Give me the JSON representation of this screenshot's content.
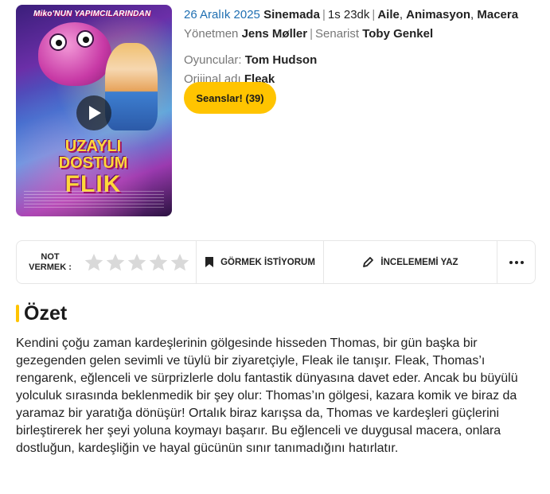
{
  "poster": {
    "topline": "NUN YAPIMCILARINDAN",
    "topline_brand": "Miko",
    "logo_line1": "UZAYLI DOSTUM",
    "logo_line2": "FLIK"
  },
  "meta": {
    "date": "26 Aralık 2025",
    "where": "Sinemada",
    "duration": "1s 23dk",
    "genres": [
      "Aile",
      "Animasyon",
      "Macera"
    ],
    "director_label": "Yönetmen",
    "director": "Jens Møller",
    "writer_label": "Senarist",
    "writer": "Toby Genkel",
    "cast_label": "Oyuncular:",
    "cast": "Tom Hudson",
    "original_label": "Orijinal adı",
    "original_title": "Fleak"
  },
  "sessions_button": "Seanslar! (39)",
  "actions": {
    "rate_label_1": "NOT",
    "rate_label_2": "VERMEK :",
    "star_count": 5,
    "star_color": "#d9d9d9",
    "watch_label": "GÖRMEK İSTİYORUM",
    "review_label": "İNCELEMEMİ YAZ"
  },
  "summary": {
    "title": "Özet",
    "text": "Kendini çoğu zaman kardeşlerinin gölgesinde hisseden Thomas, bir gün başka bir gezegenden gelen sevimli ve tüylü bir ziyaretçiyle, Fleak ile tanışır. Fleak, Thomas’ı rengarenk, eğlenceli ve sürprizlerle dolu fantastik dünyasına davet eder. Ancak bu büyülü yolculuk sırasında beklenmedik bir şey olur: Thomas’ın gölgesi, kazara komik ve biraz da yaramaz bir yaratığa dönüşür! Ortalık biraz karışsa da, Thomas ve kardeşleri güçlerini birleştirerek her şeyi yoluna koymayı başarır. Bu eğlenceli ve duygusal macera, onlara dostluğun, kardeşliğin ve hayal gücünün sınır tanımadığını hatırlatır."
  },
  "colors": {
    "accent": "#ffc400",
    "date_blue": "#1f6fb2"
  }
}
